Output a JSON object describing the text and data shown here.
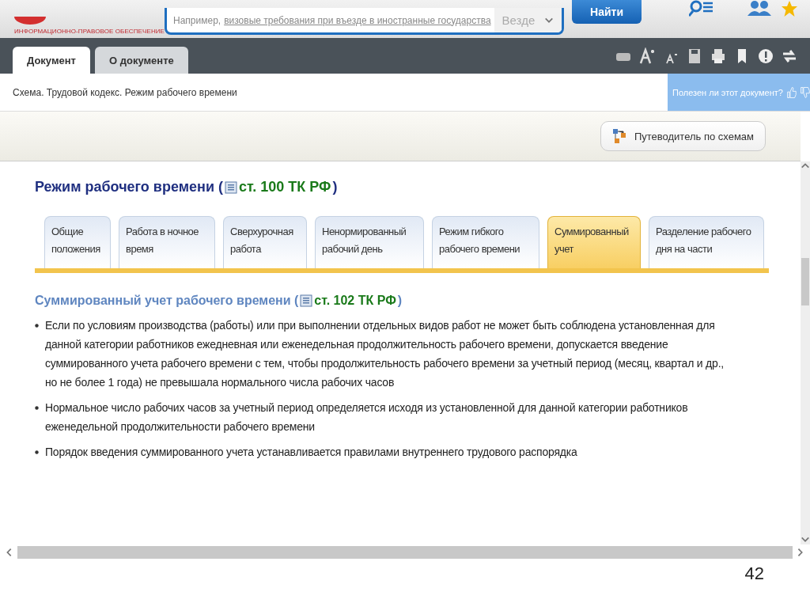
{
  "header": {
    "logo_subtitle": "ИНФОРМАЦИОННО-ПРАВОВОЕ ОБЕСПЕЧЕНИЕ",
    "search": {
      "hint": "Например,",
      "hint_link": "визовые требования при въезде в иностранные государства"
    },
    "scope": "Везде",
    "search_button": "Найти"
  },
  "doc_tabs": [
    {
      "label": "Документ",
      "selected": true
    },
    {
      "label": "О документе",
      "selected": false
    }
  ],
  "breadcrumb": "Схема. Трудовой кодекс. Режим рабочего времени",
  "feedback": "Полезен ли этот документ?",
  "guide_button": "Путеводитель по схемам",
  "title": {
    "text": "Режим рабочего времени (",
    "link": "ст. 100 ТК РФ",
    "end": ")"
  },
  "scheme_tabs": [
    {
      "label": "Общие положения",
      "selected": false
    },
    {
      "label": "Работа в ночное время",
      "selected": false
    },
    {
      "label": "Сверхурочная работа",
      "selected": false
    },
    {
      "label": "Ненормированный рабочий день",
      "selected": false
    },
    {
      "label": "Режим гибкого рабочего времени",
      "selected": false
    },
    {
      "label": "Суммированный учет",
      "selected": true
    },
    {
      "label": "Разделение рабочего дня на части",
      "selected": false
    }
  ],
  "section": {
    "text": "Суммированный учет рабочего времени (",
    "link": "ст. 102 ТК РФ",
    "end": ")"
  },
  "bullets": [
    "Если по условиям производства (работы) или при выполнении отдельных видов работ не может быть соблюдена установленная для данной категории работников ежедневная или еженедельная продолжительность рабочего времени, допускается введение суммированного учета рабочего времени с тем, чтобы продолжительность рабочего времени за учетный период (месяц, квартал и др., но не более 1 года) не превышала нормального числа рабочих часов",
    "Нормальное число рабочих часов за учетный период определяется исходя из установленной для данной категории работников еженедельной продолжительности рабочего времени",
    "Порядок введения суммированного учета устанавливается правилами внутреннего трудового распорядка"
  ],
  "slide_number": "42"
}
